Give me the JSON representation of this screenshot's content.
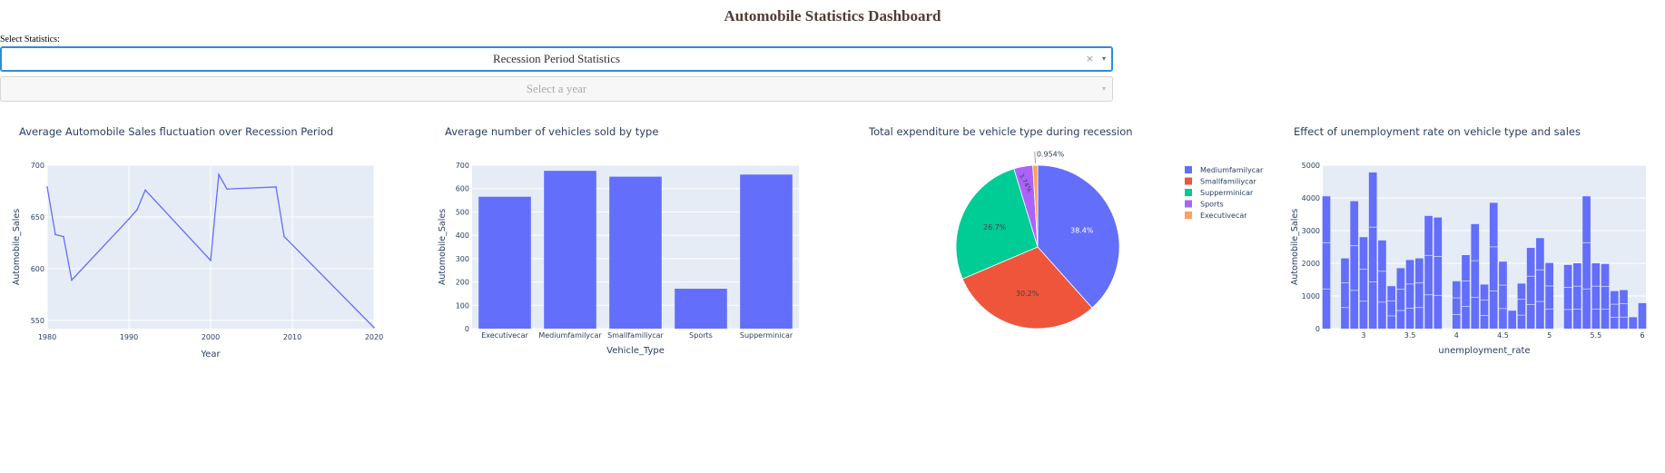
{
  "header": {
    "title": "Automobile Statistics Dashboard"
  },
  "controls": {
    "statistics_label": "Select Statistics:",
    "statistics_value": "Recession Period Statistics",
    "clear_glyph": "×",
    "arrow_glyph": "▾",
    "year_placeholder": "Select a year"
  },
  "chart_data": [
    {
      "type": "line",
      "title": "Average Automobile Sales fluctuation over Recession Period",
      "xlabel": "Year",
      "ylabel": "Automobile_Sales",
      "xlim": [
        1980,
        2020
      ],
      "ylim": [
        542,
        700
      ],
      "xticks": [
        1980,
        1990,
        2000,
        2010,
        2020
      ],
      "yticks": [
        550,
        600,
        650,
        700
      ],
      "color": "#636efa",
      "x": [
        1980,
        1981,
        1982,
        1983,
        1990,
        1991,
        1992,
        2000,
        2001,
        2002,
        2008,
        2009,
        2020
      ],
      "y": [
        679,
        633,
        631,
        589,
        648,
        657,
        676,
        608,
        691,
        677,
        679,
        631,
        543
      ]
    },
    {
      "type": "bar",
      "title": "Average number of vehicles sold by type",
      "xlabel": "Vehicle_Type",
      "ylabel": "Automobile_Sales",
      "ylim": [
        0,
        700
      ],
      "yticks": [
        0,
        100,
        200,
        300,
        400,
        500,
        600,
        700
      ],
      "color": "#636efa",
      "categories": [
        "Executivecar",
        "Mediumfamilycar",
        "Smallfamiliycar",
        "Sports",
        "Supperminicar"
      ],
      "values": [
        565,
        676,
        651,
        171,
        660
      ]
    },
    {
      "type": "pie",
      "title": "Total expenditure be vehicle type during recession",
      "labels": [
        "Mediumfamilycar",
        "Smallfamiliycar",
        "Supperminicar",
        "Sports",
        "Executivecar"
      ],
      "values": [
        38.4,
        30.2,
        26.7,
        3.74,
        0.954
      ],
      "label_text": [
        "38.4%",
        "30.2%",
        "26.7%",
        "3.74%",
        "0.954%"
      ],
      "colors": [
        "#636efa",
        "#ef553b",
        "#00cc96",
        "#ab63fa",
        "#ffa15a"
      ],
      "legend": "right"
    },
    {
      "type": "bar",
      "title": "Effect of unemployment rate on vehicle type and sales",
      "xlabel": "unemployment_rate",
      "ylabel": "Automobile_Sales",
      "xlim": [
        2.6,
        6.0
      ],
      "ylim": [
        0,
        5000
      ],
      "xticks": [
        3,
        3.5,
        4,
        4.5,
        5,
        5.5,
        6
      ],
      "yticks": [
        0,
        1000,
        2000,
        3000,
        4000,
        5000
      ],
      "color": "#636efa",
      "x": [
        2.6,
        2.8,
        2.9,
        3.0,
        3.1,
        3.2,
        3.3,
        3.4,
        3.5,
        3.6,
        3.7,
        3.8,
        4.0,
        4.1,
        4.2,
        4.3,
        4.4,
        4.5,
        4.6,
        4.7,
        4.8,
        4.9,
        5.0,
        5.2,
        5.3,
        5.4,
        5.5,
        5.6,
        5.7,
        5.8,
        5.9,
        6.0
      ],
      "values": [
        4050,
        2150,
        3900,
        2800,
        4780,
        2700,
        1300,
        1850,
        2100,
        2150,
        3450,
        3400,
        1450,
        2250,
        3200,
        1350,
        3850,
        2050,
        550,
        1380,
        2470,
        2770,
        2010,
        1950,
        2000,
        4050,
        2000,
        1980,
        1150,
        1180,
        350,
        780
      ]
    }
  ]
}
